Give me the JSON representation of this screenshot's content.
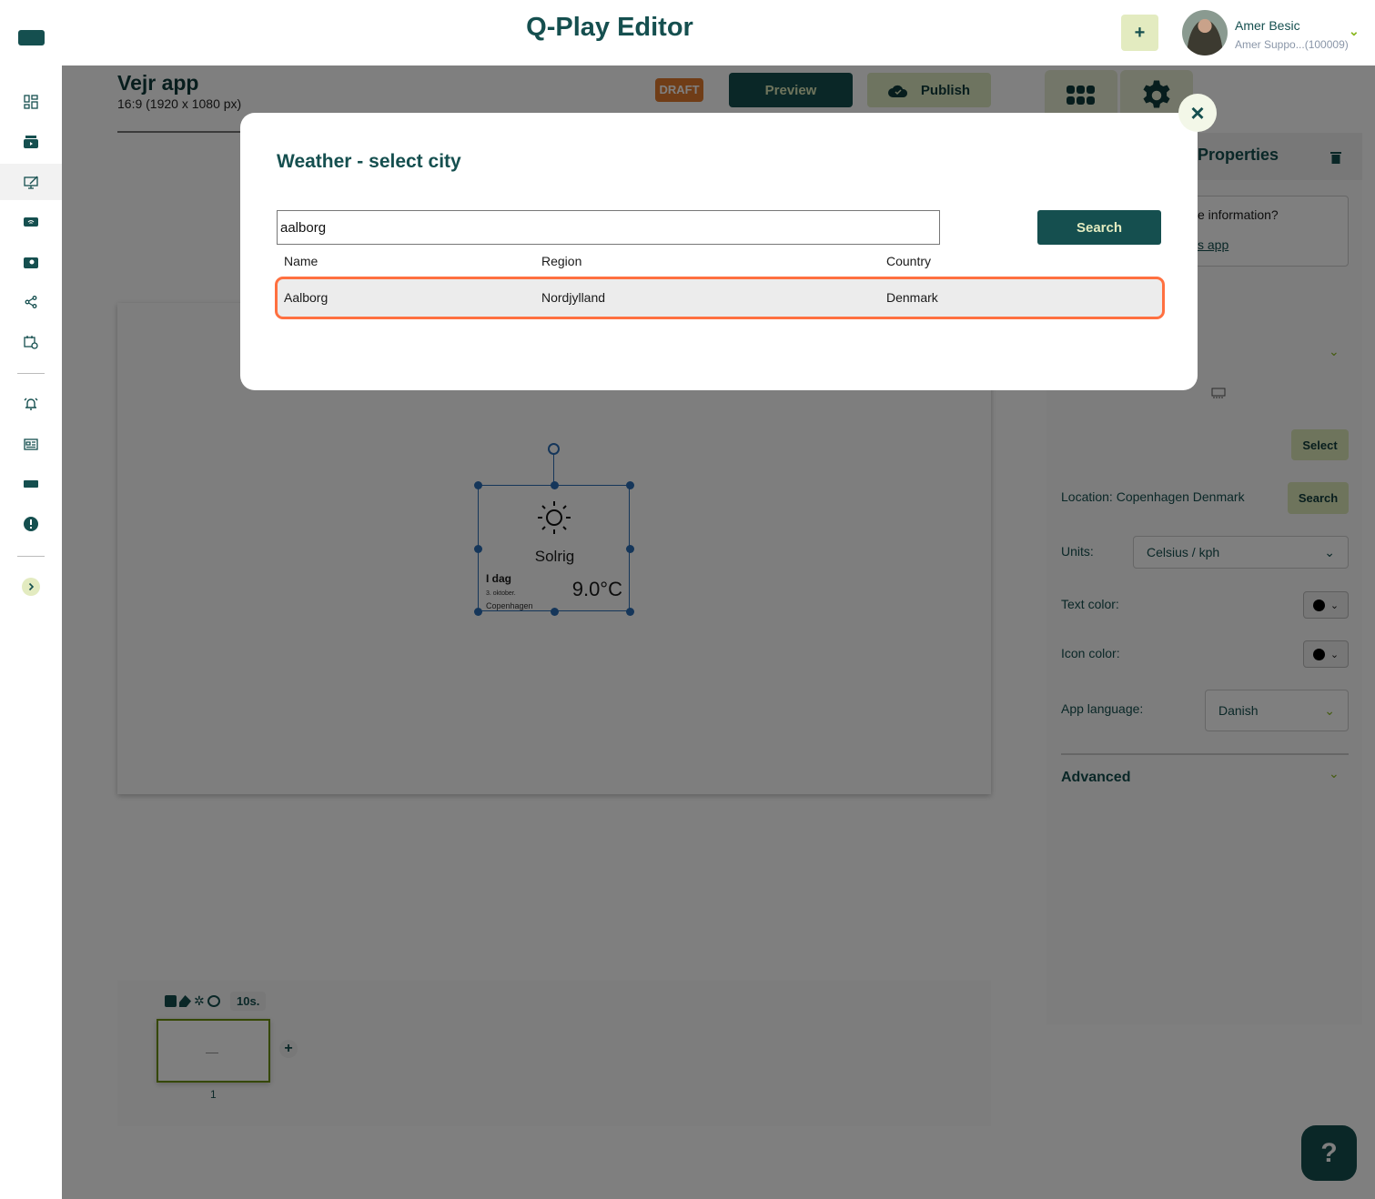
{
  "header": {
    "title": "Q-Play Editor",
    "add_label": "+",
    "user": {
      "name": "Amer Besic",
      "org": "Amer Suppo...(100009)"
    }
  },
  "app": {
    "name": "Vejr app",
    "size": "16:9 (1920 x 1080 px)",
    "status": "DRAFT",
    "preview_label": "Preview",
    "publish_label": "Publish"
  },
  "widget": {
    "condition": "Solrig",
    "day": "I dag",
    "date": "3. oktober.",
    "city": "Copenhagen",
    "temperature": "9.0°C",
    "icon": "sun-icon"
  },
  "properties": {
    "title": "Properties",
    "info_question": "e information?",
    "info_link": "s app",
    "select_label": "Select",
    "location": "Location: Copenhagen Denmark",
    "search_label": "Search",
    "units_label": "Units:",
    "units_value": "Celsius / kph",
    "text_color_label": "Text color:",
    "text_color": "#000000",
    "icon_color_label": "Icon color:",
    "icon_color": "#000000",
    "language_label": "App language:",
    "language_value": "Danish",
    "advanced_label": "Advanced"
  },
  "timeline": {
    "duration": "10s.",
    "slide_number": "1",
    "add_label": "+"
  },
  "help_label": "?",
  "modal": {
    "title": "Weather - select city",
    "search_value": "aalborg",
    "search_label": "Search",
    "columns": [
      "Name",
      "Region",
      "Country"
    ],
    "rows": [
      {
        "name": "Aalborg",
        "region": "Nordjylland",
        "country": "Denmark",
        "selected": true
      }
    ],
    "close_label": "×"
  },
  "colors": {
    "brand": "#154f4f",
    "accent": "#e3ebc0",
    "draft": "#e07a2e",
    "selection": "#ff7040"
  }
}
